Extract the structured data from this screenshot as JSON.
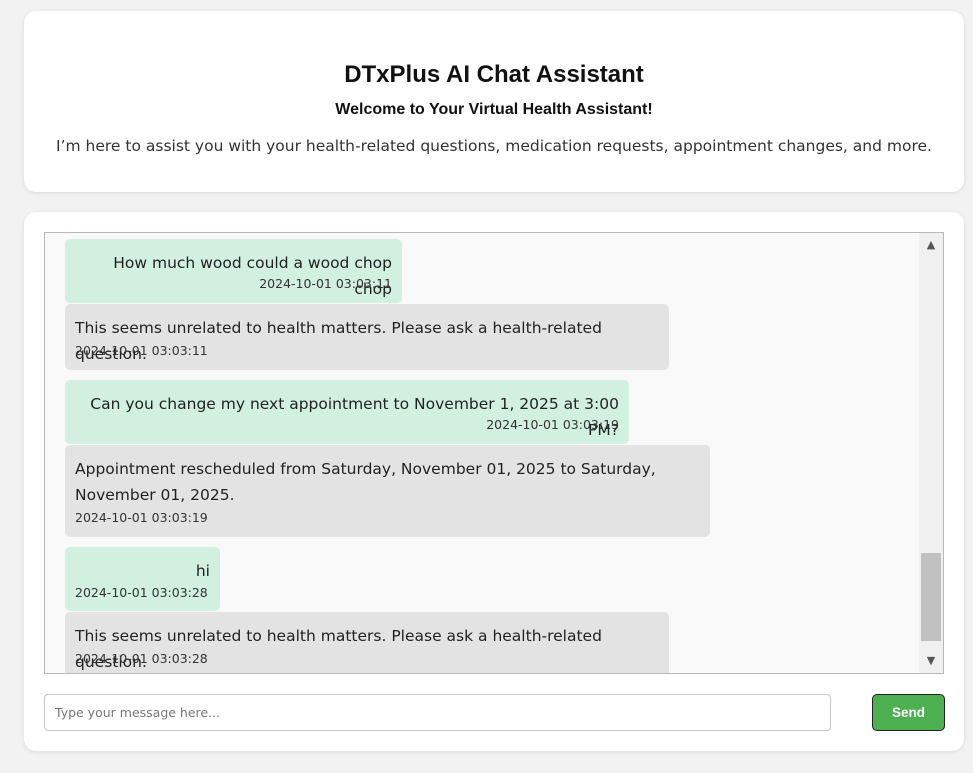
{
  "header": {
    "title": "DTxPlus AI Chat Assistant",
    "subtitle": "Welcome to Your Virtual Health Assistant!",
    "intro": "I’m here to assist you with your health-related questions, medication requests, appointment changes, and more."
  },
  "chat": {
    "messages": [
      {
        "role": "user",
        "text": "How much wood could a wood chop chop",
        "time": "2024-10-01 03:03:11"
      },
      {
        "role": "bot",
        "text": "This seems unrelated to health matters. Please ask a health-related question.",
        "time": "2024-10-01 03:03:11"
      },
      {
        "role": "user",
        "text": "Can you change my next appointment to November 1, 2025 at 3:00 PM?",
        "time": "2024-10-01 03:03:19"
      },
      {
        "role": "bot",
        "text": "Appointment rescheduled from Saturday, November 01, 2025 to Saturday, November 01, 2025.",
        "time": "2024-10-01 03:03:19"
      },
      {
        "role": "user",
        "text": "hi",
        "time": "2024-10-01 03:03:28"
      },
      {
        "role": "bot",
        "text": "This seems unrelated to health matters. Please ask a health-related question.",
        "time": "2024-10-01 03:03:28"
      }
    ]
  },
  "input": {
    "placeholder": "Type your message here...",
    "value": ""
  },
  "send_button": {
    "label": "Send"
  },
  "icons": {
    "scroll_up": "scroll-up-arrow-icon",
    "scroll_down": "scroll-down-arrow-icon"
  },
  "colors": {
    "user_bubble": "#d1f0e0",
    "bot_bubble": "#e3e3e3",
    "send_button": "#4caf50"
  }
}
